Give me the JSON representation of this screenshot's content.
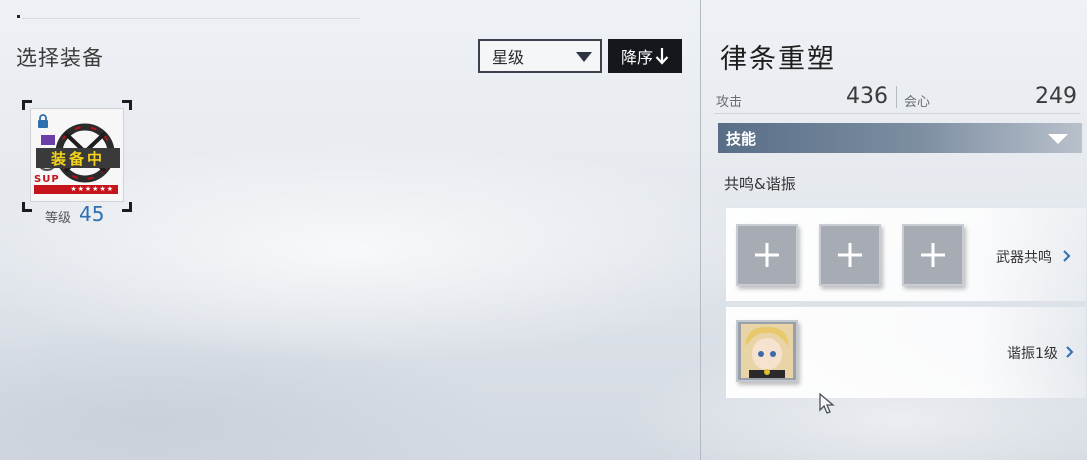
{
  "equip_panel": {
    "title": "选择装备",
    "sort_select": {
      "value": "星级"
    },
    "sort_order_label": "降序",
    "equipment": [
      {
        "status": "装备中",
        "rarity_text": "SUP",
        "stars": "★★★★★★",
        "level_label": "等级",
        "level": "45"
      }
    ]
  },
  "detail_panel": {
    "weapon_name": "律条重塑",
    "stats": [
      {
        "label": "攻击",
        "value": "436"
      },
      {
        "label": "会心",
        "value": "249"
      }
    ],
    "section_title": "技能",
    "resonance_title": "共鸣&谐振",
    "weapon_resonance_label": "武器共鸣",
    "harmony_label": "谐振1级"
  },
  "colors": {
    "accent_blue": "#2e6fb0",
    "equipped_yellow": "#f2d21a",
    "rarity_red": "#c5141c",
    "skill_bar": "#586e87"
  },
  "icons": [
    "lock-icon",
    "plus-icon",
    "chevron-right-icon",
    "chevron-down-icon",
    "arrow-down-icon",
    "cursor-icon"
  ]
}
